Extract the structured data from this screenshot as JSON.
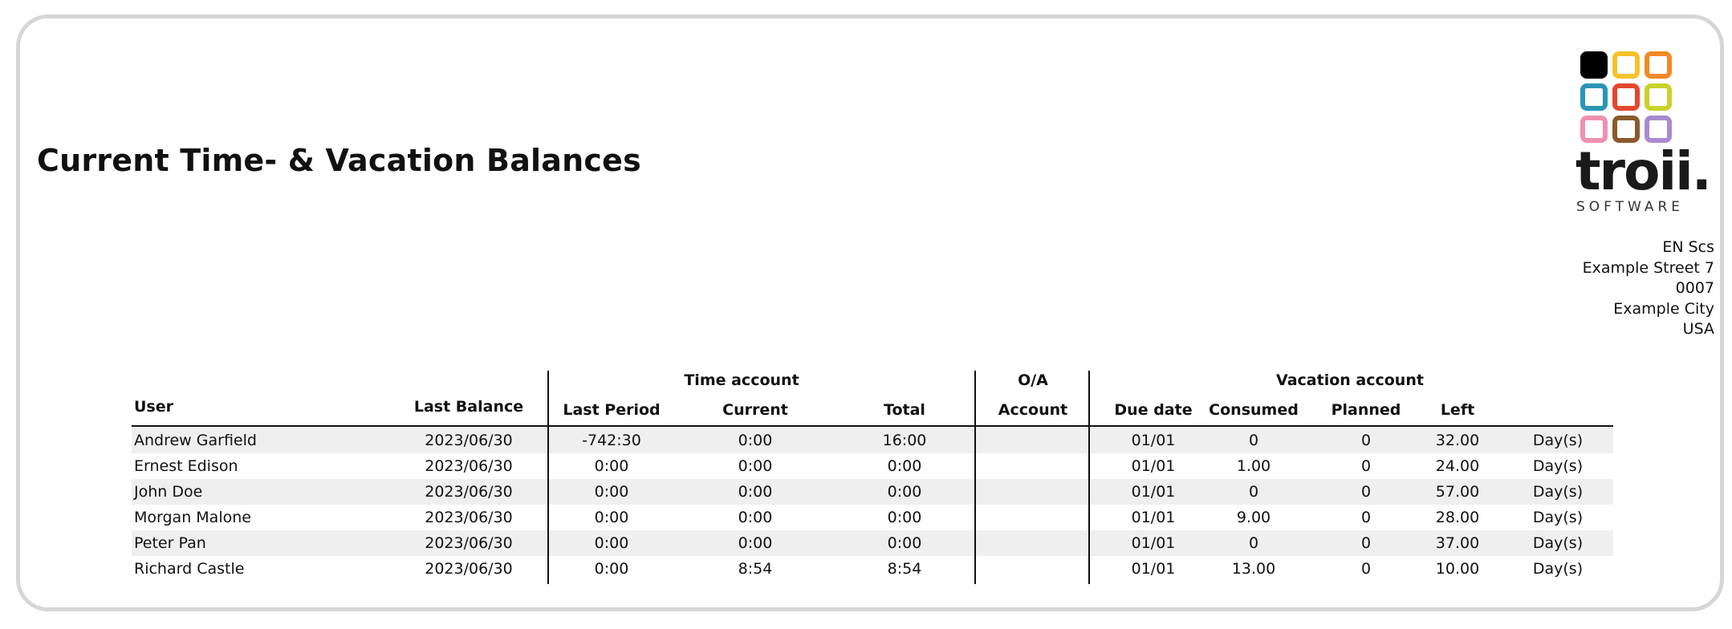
{
  "report": {
    "title": "Current Time- & Vacation Balances"
  },
  "logo": {
    "wordmark": "troii.",
    "subtitle": "SOFTWARE",
    "square_colors": [
      "#000000",
      "#f5c22a",
      "#f08a24",
      "#2a95b8",
      "#e2482d",
      "#c9d12a",
      "#ef90b0",
      "#8a5a2c",
      "#a88ad0"
    ]
  },
  "company": {
    "lines": [
      "EN Scs",
      "Example Street 7",
      "0007",
      "Example City",
      "USA"
    ]
  },
  "table": {
    "group_headers": {
      "time_account": "Time account",
      "oa": "O/A",
      "vacation_account": "Vacation account"
    },
    "columns": {
      "user": "User",
      "last_balance": "Last Balance",
      "last_period": "Last Period",
      "current": "Current",
      "total": "Total",
      "account": "Account",
      "due_date": "Due date",
      "consumed": "Consumed",
      "planned": "Planned",
      "left": "Left"
    },
    "rows": [
      {
        "user": "Andrew Garfield",
        "last_balance": "2023/06/30",
        "last_period": "-742:30",
        "current": "0:00",
        "total": "16:00",
        "account": "",
        "due_date": "01/01",
        "consumed": "0",
        "planned": "0",
        "left": "32.00",
        "unit": "Day(s)"
      },
      {
        "user": "Ernest Edison",
        "last_balance": "2023/06/30",
        "last_period": "0:00",
        "current": "0:00",
        "total": "0:00",
        "account": "",
        "due_date": "01/01",
        "consumed": "1.00",
        "planned": "0",
        "left": "24.00",
        "unit": "Day(s)"
      },
      {
        "user": "John Doe",
        "last_balance": "2023/06/30",
        "last_period": "0:00",
        "current": "0:00",
        "total": "0:00",
        "account": "",
        "due_date": "01/01",
        "consumed": "0",
        "planned": "0",
        "left": "57.00",
        "unit": "Day(s)"
      },
      {
        "user": "Morgan Malone",
        "last_balance": "2023/06/30",
        "last_period": "0:00",
        "current": "0:00",
        "total": "0:00",
        "account": "",
        "due_date": "01/01",
        "consumed": "9.00",
        "planned": "0",
        "left": "28.00",
        "unit": "Day(s)"
      },
      {
        "user": "Peter Pan",
        "last_balance": "2023/06/30",
        "last_period": "0:00",
        "current": "0:00",
        "total": "0:00",
        "account": "",
        "due_date": "01/01",
        "consumed": "0",
        "planned": "0",
        "left": "37.00",
        "unit": "Day(s)"
      },
      {
        "user": "Richard Castle",
        "last_balance": "2023/06/30",
        "last_period": "0:00",
        "current": "8:54",
        "total": "8:54",
        "account": "",
        "due_date": "01/01",
        "consumed": "13.00",
        "planned": "0",
        "left": "10.00",
        "unit": "Day(s)"
      }
    ]
  }
}
